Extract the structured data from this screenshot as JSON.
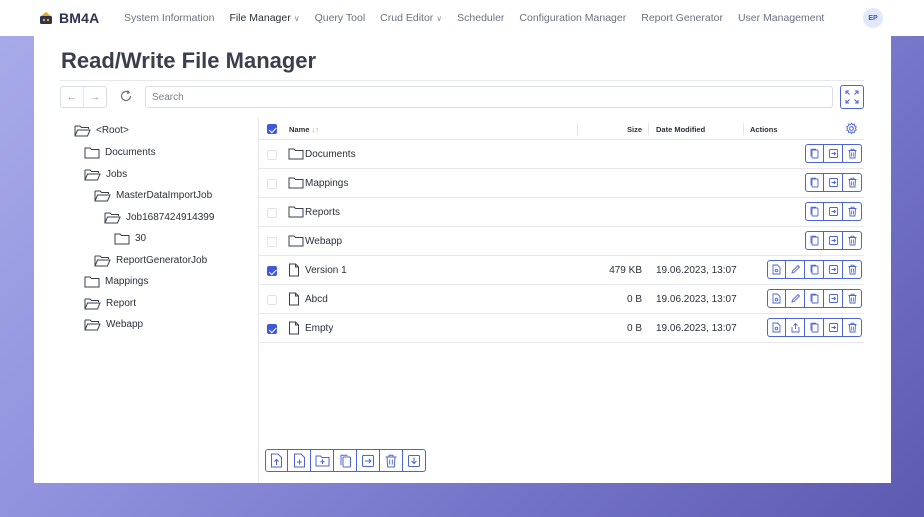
{
  "app": {
    "logo_text": "BM4A"
  },
  "nav": {
    "items": [
      {
        "label": "System Information",
        "has_dropdown": false,
        "active": false
      },
      {
        "label": "File Manager",
        "has_dropdown": true,
        "active": true
      },
      {
        "label": "Query Tool",
        "has_dropdown": false,
        "active": false
      },
      {
        "label": "Crud Editor",
        "has_dropdown": true,
        "active": false
      },
      {
        "label": "Scheduler",
        "has_dropdown": false,
        "active": false
      },
      {
        "label": "Configuration Manager",
        "has_dropdown": false,
        "active": false
      },
      {
        "label": "Report Generator",
        "has_dropdown": false,
        "active": false
      },
      {
        "label": "User Management",
        "has_dropdown": false,
        "active": false
      }
    ],
    "user_initials": "EP"
  },
  "page": {
    "title": "Read/Write File Manager"
  },
  "toolbar": {
    "search_placeholder": "Search"
  },
  "tree": {
    "items": [
      {
        "label": "<Root>",
        "open": true
      },
      {
        "label": "Documents",
        "open": false
      },
      {
        "label": "Jobs",
        "open": true
      },
      {
        "label": "MasterDataImportJob",
        "open": true
      },
      {
        "label": "Job1687424914399",
        "open": true
      },
      {
        "label": "30",
        "open": false
      },
      {
        "label": "ReportGeneratorJob",
        "open": true
      },
      {
        "label": "Mappings",
        "open": false
      },
      {
        "label": "Report",
        "open": true
      },
      {
        "label": "Webapp",
        "open": true
      }
    ]
  },
  "grid": {
    "columns": {
      "name": "Name",
      "size": "Size",
      "date": "Date Modified",
      "actions": "Actions"
    },
    "header_checked": true,
    "rows": [
      {
        "type": "folder",
        "name": "Documents",
        "size": "",
        "date": "",
        "checked": false,
        "actions": [
          "copy",
          "move",
          "delete"
        ]
      },
      {
        "type": "folder",
        "name": "Mappings",
        "size": "",
        "date": "",
        "checked": false,
        "actions": [
          "copy",
          "move",
          "delete"
        ]
      },
      {
        "type": "folder",
        "name": "Reports",
        "size": "",
        "date": "",
        "checked": false,
        "actions": [
          "copy",
          "move",
          "delete"
        ]
      },
      {
        "type": "folder",
        "name": "Webapp",
        "size": "",
        "date": "",
        "checked": false,
        "actions": [
          "copy",
          "move",
          "delete"
        ]
      },
      {
        "type": "file",
        "name": "Version 1",
        "size": "479 KB",
        "date": "19.06.2023, 13:07",
        "checked": true,
        "actions": [
          "view",
          "edit",
          "copy",
          "move",
          "delete"
        ]
      },
      {
        "type": "file",
        "name": "Abcd",
        "size": "0 B",
        "date": "19.06.2023, 13:07",
        "checked": false,
        "actions": [
          "view",
          "edit",
          "copy",
          "move",
          "delete"
        ]
      },
      {
        "type": "file",
        "name": "Empty",
        "size": "0 B",
        "date": "19.06.2023, 13:07",
        "checked": true,
        "actions": [
          "view",
          "upload",
          "copy",
          "move",
          "delete"
        ]
      }
    ]
  },
  "bottom_toolbar": {
    "buttons": [
      "upload-file",
      "new-file",
      "new-folder",
      "copy",
      "move",
      "delete",
      "download"
    ]
  },
  "colors": {
    "accent": "#3f59d8",
    "background_gradient_start": "#a9acea",
    "background_gradient_end": "#5d5bb0"
  }
}
